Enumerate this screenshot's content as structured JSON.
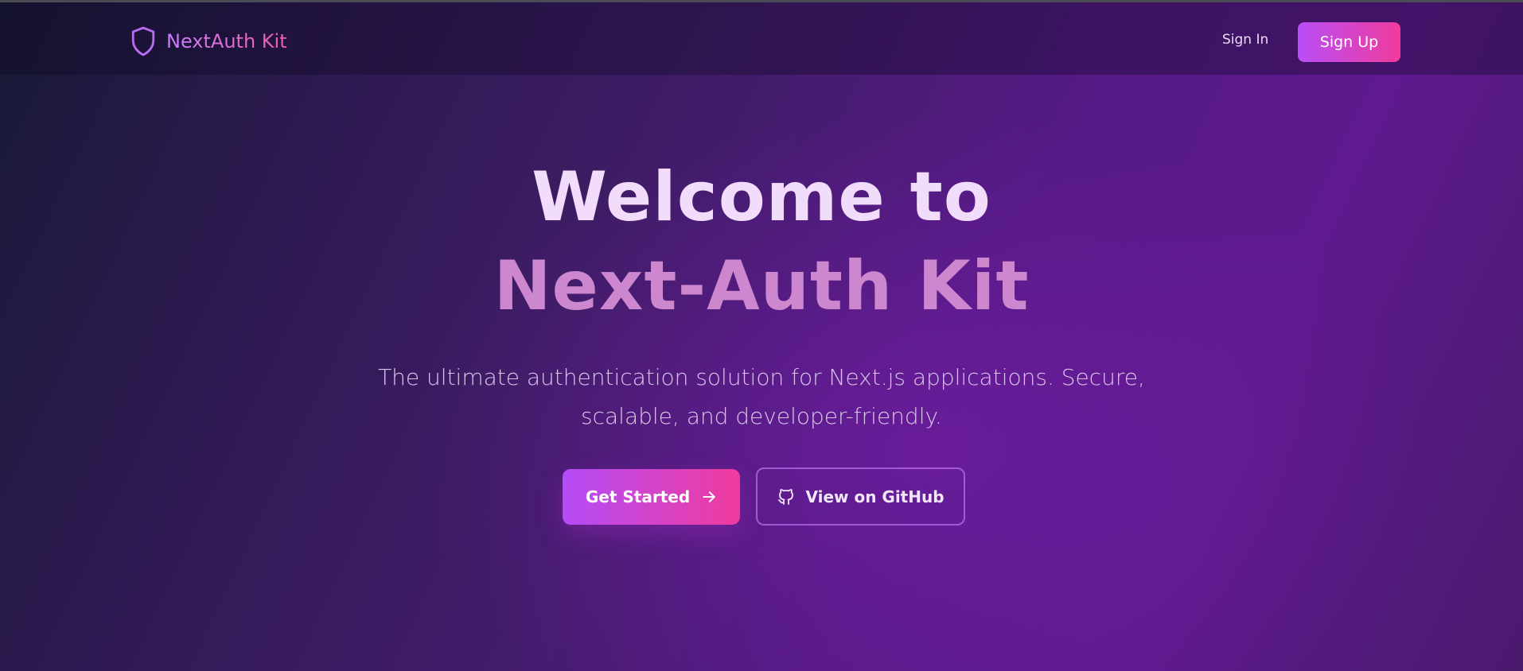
{
  "brand": {
    "name": "NextAuth Kit",
    "icon": "shield-icon"
  },
  "nav": {
    "signin_label": "Sign In",
    "signup_label": "Sign Up"
  },
  "hero": {
    "title_line1": "Welcome to",
    "title_line2": "Next-Auth Kit",
    "subtitle": "The ultimate authentication solution for Next.js applications. Secure, scalable, and developer-friendly.",
    "primary_button": {
      "label": "Get Started",
      "icon": "arrow-right-icon"
    },
    "secondary_button": {
      "label": "View on GitHub",
      "icon": "github-icon"
    }
  },
  "colors": {
    "accent_start": "#b94ef7",
    "accent_end": "#f03b9c",
    "title_light": "#f1ddfb",
    "title_pink": "#cc87cf"
  }
}
